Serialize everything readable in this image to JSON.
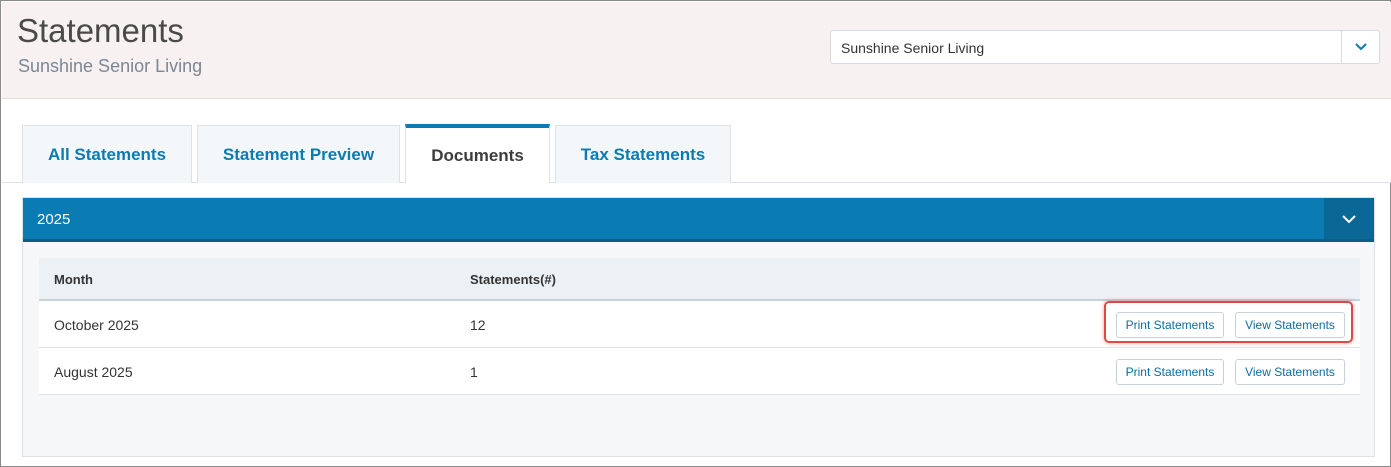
{
  "header": {
    "title": "Statements",
    "subtitle": "Sunshine Senior Living",
    "facility_select": {
      "value": "Sunshine Senior Living",
      "toggle_icon": "chevron-down-icon"
    }
  },
  "tabs": [
    {
      "label": "All Statements",
      "active": false
    },
    {
      "label": "Statement Preview",
      "active": false
    },
    {
      "label": "Documents",
      "active": true
    },
    {
      "label": "Tax Statements",
      "active": false
    }
  ],
  "panel": {
    "year": "2025",
    "collapse_icon": "chevron-down-icon",
    "columns": [
      "Month",
      "Statements(#)"
    ],
    "rows": [
      {
        "month": "October 2025",
        "count": "12",
        "print_label": "Print Statements",
        "view_label": "View Statements",
        "highlighted": true
      },
      {
        "month": "August 2025",
        "count": "1",
        "print_label": "Print Statements",
        "view_label": "View Statements",
        "highlighted": false
      }
    ]
  },
  "colors": {
    "accent": "#0a7bb3",
    "highlight": "#e04848"
  }
}
